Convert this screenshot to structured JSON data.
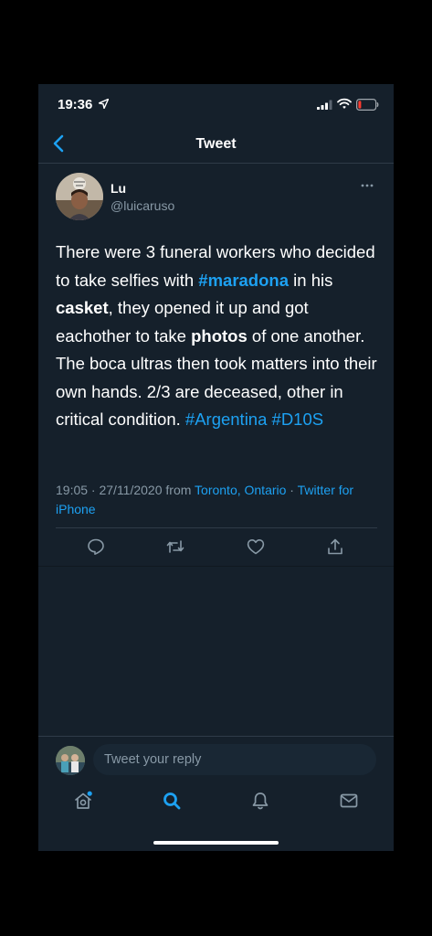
{
  "status_bar": {
    "time": "19:36"
  },
  "header": {
    "title": "Tweet"
  },
  "tweet": {
    "author_name": "Lu",
    "author_handle": "@luicaruso",
    "text_parts": {
      "p1": "There were 3 funeral workers who decided to take selfies with ",
      "p2": "#maradona",
      "p3": " in his ",
      "p4": "casket",
      "p5": ", they opened it up and got eachother to take ",
      "p6": "photos",
      "p7": " of one another. The boca ultras then took matters into their own hands. 2/3 are deceased, other in critical condition. ",
      "p8": "#Argentina",
      "p9": " ",
      "p10": "#D10S"
    },
    "meta": {
      "datetime": "19:05 · 27/11/2020 from ",
      "location": "Toronto, Ontario",
      "separator": " · ",
      "client": "Twitter for iPhone"
    }
  },
  "reply": {
    "placeholder": "Tweet your reply"
  },
  "icons": {
    "back": "chevron-left-icon",
    "more": "more-horizontal-icon",
    "reply": "comment-icon",
    "retweet": "retweet-icon",
    "like": "heart-icon",
    "share": "share-icon",
    "home": "home-icon",
    "search": "search-icon",
    "notifications": "bell-icon",
    "messages": "mail-icon"
  },
  "colors": {
    "background": "#15202b",
    "accent": "#1da1f2",
    "secondary_text": "#8899a6",
    "battery_low": "#ff3b30"
  }
}
